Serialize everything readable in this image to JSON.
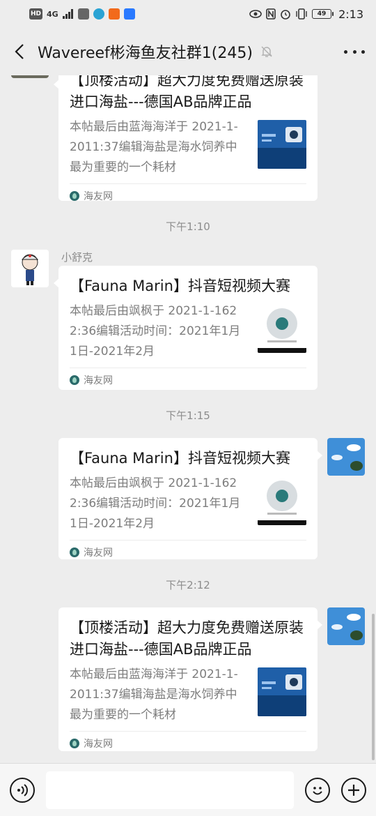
{
  "status_bar": {
    "hd": "HD",
    "network": "4G",
    "battery": "49",
    "time": "2:13"
  },
  "nav": {
    "title": "Wavereef彬海鱼友社群1(245)"
  },
  "messages": [
    {
      "title": "【顶楼活动】超大力度免费赠送原装进口海盐---德国AB品牌正品",
      "desc": "本帖最后由蓝海海洋于 2021-1-2011:37编辑海盐是海水饲养中最为重要的一个耗材",
      "source": "海友网"
    },
    {
      "timestamp": "下午1:10",
      "sender": "小舒克",
      "title": "【Fauna Marin】抖音短视频大赛",
      "desc": "本帖最后由飒枫于 2021-1-1622:36编辑活动时间：2021年1月1日-2021年2月",
      "source": "海友网"
    },
    {
      "timestamp": "下午1:15",
      "title": "【Fauna Marin】抖音短视频大赛",
      "desc": "本帖最后由飒枫于 2021-1-1622:36编辑活动时间：2021年1月1日-2021年2月",
      "source": "海友网"
    },
    {
      "timestamp": "下午2:12",
      "title": "【顶楼活动】超大力度免费赠送原装进口海盐---德国AB品牌正品",
      "desc": "本帖最后由蓝海海洋于 2021-1-2011:37编辑海盐是海水饲养中最为重要的一个耗材",
      "source": "海友网"
    }
  ],
  "icons": {
    "back": "chevron-left-icon",
    "mute": "bell-off-icon",
    "more": "more-dots-icon",
    "voice": "voice-icon",
    "emoji": "emoji-icon",
    "add": "plus-icon"
  }
}
